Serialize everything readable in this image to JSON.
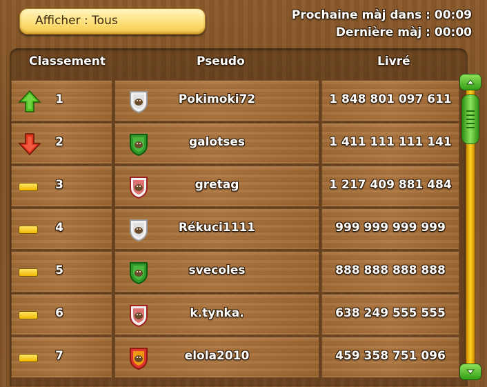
{
  "filter": {
    "label": "Afficher : Tous"
  },
  "timers": {
    "next_update": "Prochaine màj dans : 00:09",
    "last_update": "Dernière màj : 00:00"
  },
  "columns": {
    "rank": "Classement",
    "player": "Pseudo",
    "delivered": "Livré"
  },
  "rows": [
    {
      "trend": "up",
      "rank": "1",
      "pseudo": "Pokimoki72",
      "delivered": "1 848 801 097 611",
      "emblem": "white"
    },
    {
      "trend": "down",
      "rank": "2",
      "pseudo": "galotses",
      "delivered": "1 411 111 111 141",
      "emblem": "green"
    },
    {
      "trend": "same",
      "rank": "3",
      "pseudo": "gretag",
      "delivered": "1 217 409 881 484",
      "emblem": "red-white"
    },
    {
      "trend": "same",
      "rank": "4",
      "pseudo": "Rékuci1111",
      "delivered": "999 999 999 999",
      "emblem": "white"
    },
    {
      "trend": "same",
      "rank": "5",
      "pseudo": "svecoles",
      "delivered": "888 888 888 888",
      "emblem": "green"
    },
    {
      "trend": "same",
      "rank": "6",
      "pseudo": "k.tynka.",
      "delivered": "638 249 555 555",
      "emblem": "red-white"
    },
    {
      "trend": "same",
      "rank": "7",
      "pseudo": "elola2010",
      "delivered": "459 358 751 096",
      "emblem": "red-gold"
    }
  ],
  "colors": {
    "up": "#4cbf1e",
    "down": "#e0341b",
    "same": "#f5c400",
    "accent": "#fde07a"
  }
}
